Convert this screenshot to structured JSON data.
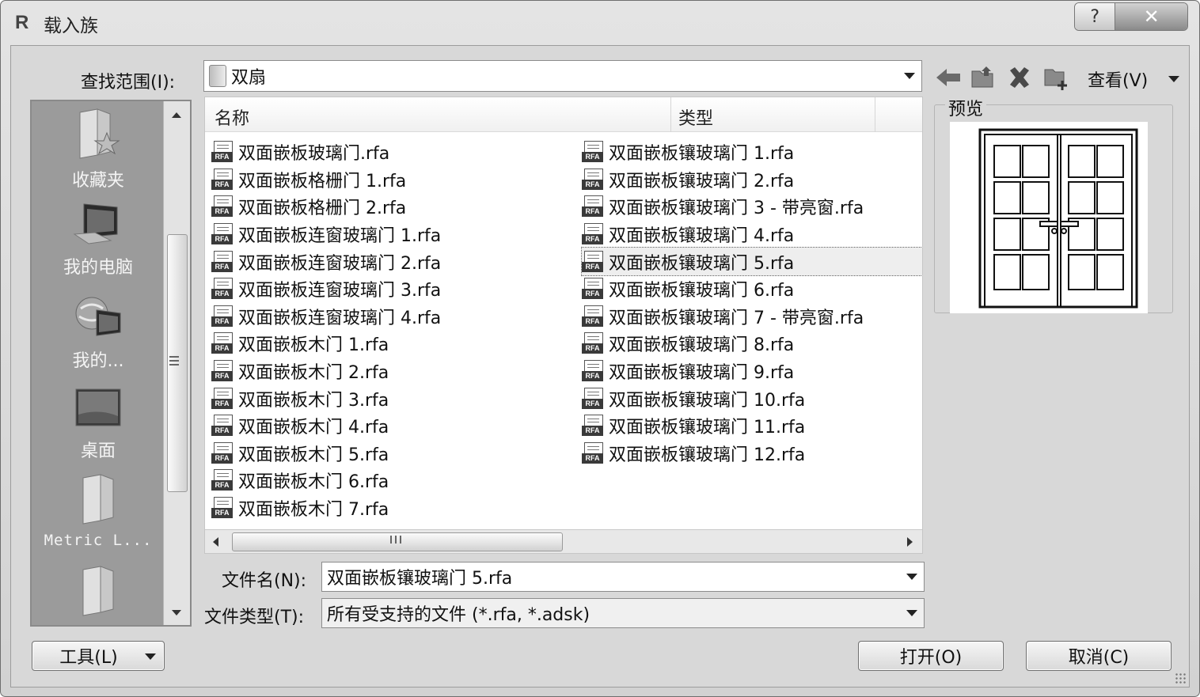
{
  "window": {
    "title": "载入族",
    "app_icon_letter": "R",
    "help_glyph": "?",
    "close_glyph": "✕"
  },
  "look_in": {
    "label": "查找范围(I):",
    "value": "双扇"
  },
  "toolbar": {
    "views_label": "查看(V)"
  },
  "places": [
    {
      "label": "收藏夹",
      "icon": "favorites-folder-icon"
    },
    {
      "label": "我的电脑",
      "icon": "my-computer-icon"
    },
    {
      "label": "我的...",
      "icon": "network-places-icon"
    },
    {
      "label": "桌面",
      "icon": "desktop-icon"
    },
    {
      "label": "Metric L...",
      "icon": "folder-icon"
    },
    {
      "label": "",
      "icon": "folder-icon"
    }
  ],
  "file_list": {
    "columns": [
      "名称",
      "类型"
    ],
    "selected": "双面嵌板镶玻璃门 5.rfa",
    "left_column": [
      "双面嵌板玻璃门.rfa",
      "双面嵌板格栅门 1.rfa",
      "双面嵌板格栅门 2.rfa",
      "双面嵌板连窗玻璃门 1.rfa",
      "双面嵌板连窗玻璃门 2.rfa",
      "双面嵌板连窗玻璃门 3.rfa",
      "双面嵌板连窗玻璃门 4.rfa",
      "双面嵌板木门 1.rfa",
      "双面嵌板木门 2.rfa",
      "双面嵌板木门 3.rfa",
      "双面嵌板木门 4.rfa",
      "双面嵌板木门 5.rfa",
      "双面嵌板木门 6.rfa",
      "双面嵌板木门 7.rfa"
    ],
    "right_column": [
      "双面嵌板镶玻璃门 1.rfa",
      "双面嵌板镶玻璃门 2.rfa",
      "双面嵌板镶玻璃门 3 - 带亮窗.rfa",
      "双面嵌板镶玻璃门 4.rfa",
      "双面嵌板镶玻璃门 5.rfa",
      "双面嵌板镶玻璃门 6.rfa",
      "双面嵌板镶玻璃门 7 - 带亮窗.rfa",
      "双面嵌板镶玻璃门 8.rfa",
      "双面嵌板镶玻璃门 9.rfa",
      "双面嵌板镶玻璃门 10.rfa",
      "双面嵌板镶玻璃门 11.rfa",
      "双面嵌板镶玻璃门 12.rfa"
    ],
    "file_icon_tag": "RFA"
  },
  "preview": {
    "label": "预览"
  },
  "file_name": {
    "label": "文件名(N):",
    "value": "双面嵌板镶玻璃门 5.rfa"
  },
  "file_type": {
    "label": "文件类型(T):",
    "value": "所有受支持的文件 (*.rfa, *.adsk)"
  },
  "buttons": {
    "tools": "工具(L)",
    "open": "打开(O)",
    "cancel": "取消(C)"
  }
}
